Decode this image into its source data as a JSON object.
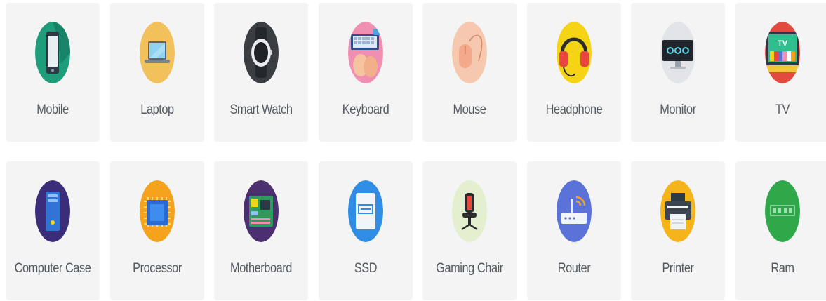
{
  "categories": [
    {
      "label": "Mobile",
      "icon": "mobile-icon",
      "color": "#1f9c7a"
    },
    {
      "label": "Laptop",
      "icon": "laptop-icon",
      "color": "#f2c15c"
    },
    {
      "label": "Smart Watch",
      "icon": "smart-watch-icon",
      "color": "#3a3d42"
    },
    {
      "label": "Keyboard",
      "icon": "keyboard-icon",
      "color": "#f08fb1"
    },
    {
      "label": "Mouse",
      "icon": "mouse-icon",
      "color": "#f6c8b0"
    },
    {
      "label": "Headphone",
      "icon": "headphone-icon",
      "color": "#f5d415"
    },
    {
      "label": "Monitor",
      "icon": "monitor-icon",
      "color": "#e2e4e7"
    },
    {
      "label": "TV",
      "icon": "tv-icon",
      "color": "#e24a3f"
    },
    {
      "label": "Computer Case",
      "icon": "computer-case-icon",
      "color": "#3b2d7a"
    },
    {
      "label": "Processor",
      "icon": "processor-icon",
      "color": "#f5a31c"
    },
    {
      "label": "Motherboard",
      "icon": "motherboard-icon",
      "color": "#4b2f6e"
    },
    {
      "label": "SSD",
      "icon": "ssd-icon",
      "color": "#2f8de6"
    },
    {
      "label": "Gaming Chair",
      "icon": "gaming-chair-icon",
      "color": "#e3efcf"
    },
    {
      "label": "Router",
      "icon": "router-icon",
      "color": "#5b72d8"
    },
    {
      "label": "Printer",
      "icon": "printer-icon",
      "color": "#f5b41a"
    },
    {
      "label": "Ram",
      "icon": "ram-icon",
      "color": "#2fa84a"
    }
  ]
}
